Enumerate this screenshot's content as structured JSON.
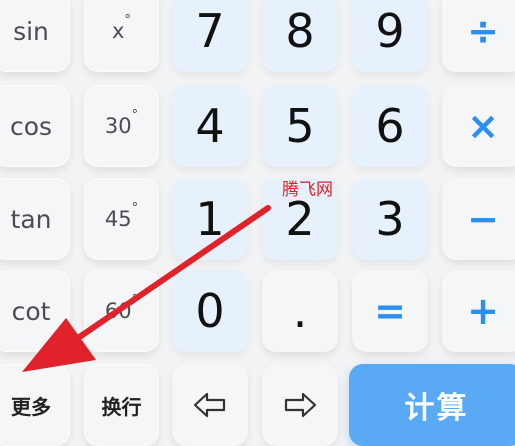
{
  "func_keys": {
    "sin": "sin",
    "x_deg_base": "x",
    "deg_symbol": "°",
    "cos": "cos",
    "deg30": "30",
    "tan": "tan",
    "deg45": "45",
    "cot": "cot",
    "deg60": "60"
  },
  "digits": {
    "d7": "7",
    "d8": "8",
    "d9": "9",
    "d4": "4",
    "d5": "5",
    "d6": "6",
    "d1": "1",
    "d2": "2",
    "d3": "3",
    "d0": "0",
    "dot": "."
  },
  "operators": {
    "divide": "÷",
    "multiply": "×",
    "minus": "−",
    "plus": "+",
    "equals": "="
  },
  "bottom_row": {
    "more": "更多",
    "newline": "换行",
    "calculate": "计算"
  },
  "watermark": "腾飞网",
  "colors": {
    "accent": "#2b8ff0",
    "calc_button": "#5aa9f4",
    "number_key_bg": "#e6f1fc",
    "arrow": "#e0232a"
  }
}
